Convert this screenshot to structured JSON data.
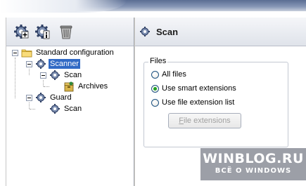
{
  "tree": {
    "items": [
      {
        "label": "Standard configuration",
        "icon": "folder-icon"
      },
      {
        "label": "Scanner",
        "icon": "scanner-icon",
        "selected": true
      },
      {
        "label": "Scan",
        "icon": "scan-task-icon"
      },
      {
        "label": "Archives",
        "icon": "archives-icon"
      },
      {
        "label": "Guard",
        "icon": "guard-icon"
      },
      {
        "label": "Scan",
        "icon": "scan-task-icon"
      }
    ]
  },
  "toolbar": {
    "buttons": [
      {
        "icon": "add-gear-icon"
      },
      {
        "icon": "properties-gear-icon"
      },
      {
        "icon": "trash-icon"
      }
    ]
  },
  "header": {
    "title": "Scan",
    "icon": "scan-task-icon"
  },
  "files_group": {
    "legend": "Files",
    "options": [
      {
        "label": "All files",
        "checked": false
      },
      {
        "label": "Use smart extensions",
        "checked": true
      },
      {
        "label": "Use file extension list",
        "checked": false
      }
    ],
    "button_accel": "F",
    "button_rest": "ile extensions"
  },
  "watermark": {
    "line1": "WINBLOG.RU",
    "line2": "ВСЁ О WINDOWS"
  },
  "colors": {
    "selection": "#316ac5",
    "radio_check": "#21a121",
    "header_bg": "#dfe3ea"
  }
}
